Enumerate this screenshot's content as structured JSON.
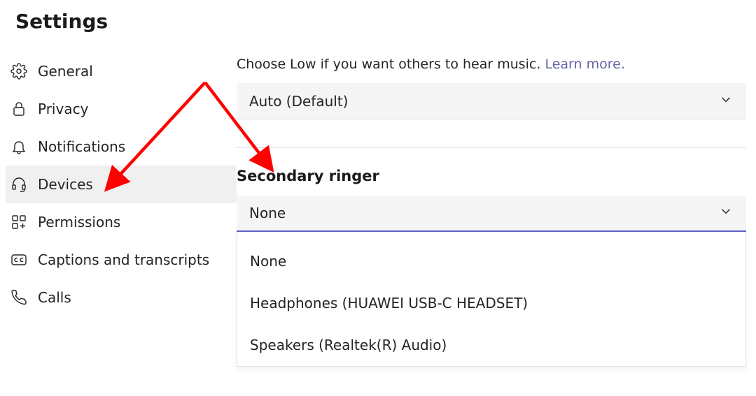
{
  "page_title": "Settings",
  "sidebar": {
    "items": [
      {
        "icon": "gear-icon",
        "label": "General",
        "selected": false
      },
      {
        "icon": "lock-icon",
        "label": "Privacy",
        "selected": false
      },
      {
        "icon": "bell-icon",
        "label": "Notifications",
        "selected": false
      },
      {
        "icon": "headset-icon",
        "label": "Devices",
        "selected": true
      },
      {
        "icon": "grid-plus-icon",
        "label": "Permissions",
        "selected": false
      },
      {
        "icon": "cc-icon",
        "label": "Captions and transcripts",
        "selected": false
      },
      {
        "icon": "phone-icon",
        "label": "Calls",
        "selected": false
      }
    ]
  },
  "main": {
    "help_text": "Choose Low if you want others to hear music. ",
    "learn_more": "Learn more.",
    "noise_suppression": {
      "selected": "Auto (Default)"
    },
    "secondary_ringer": {
      "heading": "Secondary ringer",
      "selected": "None",
      "options": [
        "None",
        "Headphones (HUAWEI USB-C HEADSET)",
        "Speakers (Realtek(R) Audio)"
      ]
    }
  },
  "annotation": {
    "color": "#ff0000"
  }
}
